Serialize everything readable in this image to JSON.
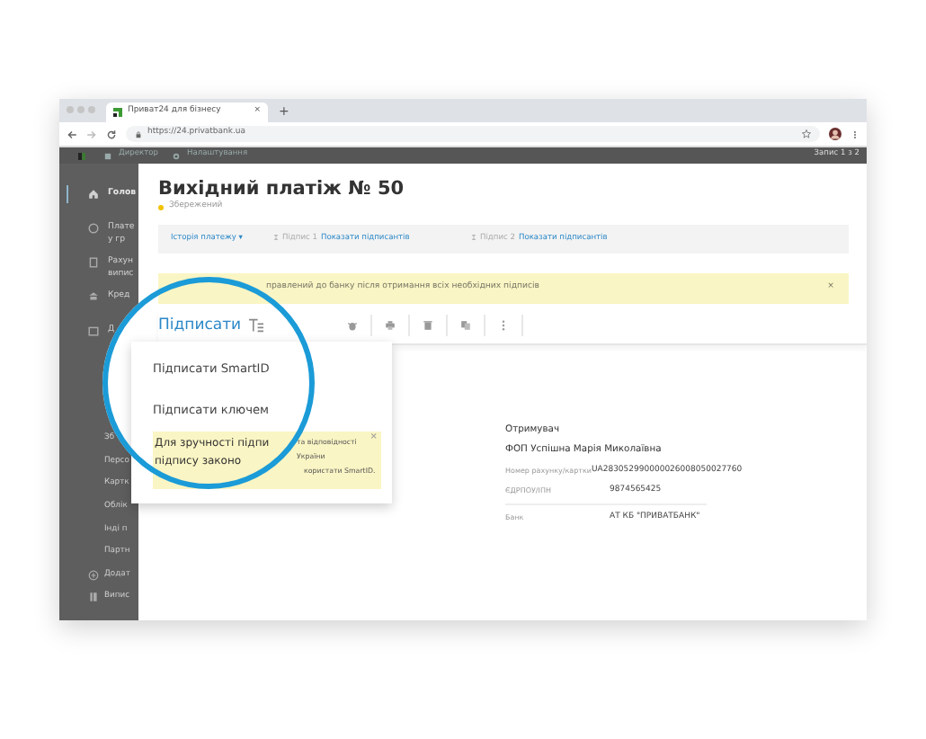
{
  "browser": {
    "tab_title": "Приват24 для бізнесу",
    "tab_close": "×",
    "new_tab": "+",
    "url": "https://24.privatbank.ua"
  },
  "topbar": {
    "items": [
      "Директор",
      "Налаштування"
    ],
    "record": "Запис 1 з 2"
  },
  "sidebar": {
    "items": [
      {
        "label": "Голов",
        "selected": true
      },
      {
        "label": "Плате",
        "sub": "у гр",
        "selected": false
      },
      {
        "label": "Рахун",
        "sub": "випис",
        "selected": false
      },
      {
        "label": "Кред",
        "selected": false
      },
      {
        "label": "Д",
        "selected": false
      }
    ],
    "more_items": [
      {
        "label": "Зб",
        "kind": "text"
      },
      {
        "label": "Персо",
        "kind": "text"
      },
      {
        "label": "Картк",
        "kind": "text"
      },
      {
        "label": "Облік",
        "kind": "text"
      },
      {
        "label": "Інді п",
        "kind": "text"
      },
      {
        "label": "Партн",
        "kind": "text"
      },
      {
        "label": "Додат",
        "kind": "icon"
      },
      {
        "label": "Випис",
        "kind": "icon"
      }
    ]
  },
  "document": {
    "title": "Вихідний платіж № 50",
    "status": "Збережений",
    "history": "Історія платежу",
    "history_caret": "▾",
    "signatures": [
      {
        "label": "Підпис 1",
        "link": "Показати підписантів"
      },
      {
        "label": "Підпис 2",
        "link": "Показати підписантів"
      }
    ],
    "alert": {
      "text": "правлений до банку після отримання всіх необхідних підписів",
      "close": "×"
    },
    "sign_button": "Підписати"
  },
  "sign_menu": {
    "items": [
      "Підписати SmartID",
      "Підписати ключем"
    ],
    "note": {
      "big_lines": [
        "Для зручності підпи",
        "підпису законо"
      ],
      "small_lines": [
        "та відповідності",
        "України",
        "користати SmartID."
      ],
      "close": "×"
    }
  },
  "recipient": {
    "heading": "Отримувач",
    "name": "ФОП Успішна Марія Миколаївна",
    "rows": [
      {
        "label": "Номер рахунку/картки",
        "value": "UA283052990000026008050027760"
      },
      {
        "label": "ЄДРПОУ/ІПН",
        "value": "9874565425"
      },
      {
        "label": "Банк",
        "value": "АТ КБ \"ПРИВАТБАНК\"",
        "divider": true
      }
    ]
  }
}
